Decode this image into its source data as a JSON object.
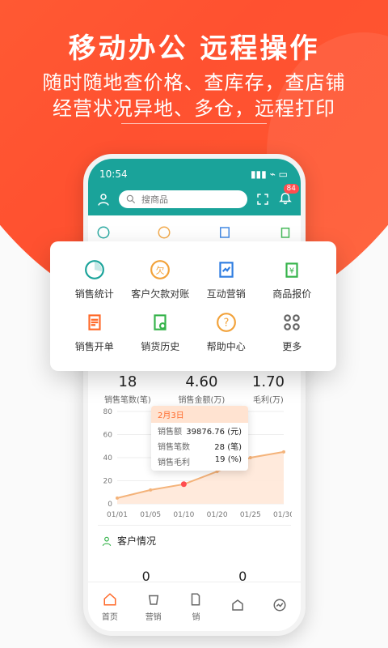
{
  "hero": {
    "title": "移动办公 远程操作",
    "subtitle_line1": "随时随地查价格、查库存，查店铺",
    "subtitle_line2": "经营状况异地、多仓，远程打印"
  },
  "phone": {
    "status_time": "10:54",
    "search_placeholder": "搜商品",
    "badge_count": "84",
    "stats": [
      {
        "value": "18",
        "label": "销售笔数(笔)"
      },
      {
        "value": "4.60",
        "label": "销售金额(万)"
      },
      {
        "value": "1.70",
        "label": "毛利(万)"
      }
    ],
    "tooltip": {
      "date": "2月3日",
      "rows": [
        {
          "label": "销售额",
          "value": "39876.76",
          "unit": "(元)"
        },
        {
          "label": "销售笔数",
          "value": "28",
          "unit": "(笔)"
        },
        {
          "label": "销售毛利",
          "value": "19",
          "unit": "(%)"
        }
      ]
    },
    "chart_data": {
      "type": "area",
      "x": [
        "01/01",
        "01/05",
        "01/10",
        "01/20",
        "01/25",
        "01/30"
      ],
      "y_ticks": [
        0,
        20,
        40,
        60,
        80
      ],
      "series": [
        {
          "values": [
            5,
            12,
            17,
            28,
            40,
            45
          ]
        }
      ],
      "ylim": [
        0,
        80
      ]
    },
    "section": {
      "title": "客户情况",
      "values": [
        "0",
        "0"
      ]
    },
    "tabs": [
      "首页",
      "营销",
      "销",
      "",
      ""
    ]
  },
  "popup": {
    "items": [
      {
        "label": "销售统计",
        "icon": "sales-stats-icon"
      },
      {
        "label": "客户欠款对账",
        "icon": "customer-debt-icon"
      },
      {
        "label": "互动营销",
        "icon": "interactive-marketing-icon"
      },
      {
        "label": "商品报价",
        "icon": "product-quote-icon"
      },
      {
        "label": "销售开单",
        "icon": "sales-order-icon"
      },
      {
        "label": "销货历史",
        "icon": "sales-history-icon"
      },
      {
        "label": "帮助中心",
        "icon": "help-center-icon"
      },
      {
        "label": "更多",
        "icon": "more-icon"
      }
    ]
  },
  "colors": {
    "accent_orange": "#ff5a2e",
    "teal": "#1aa39a"
  }
}
